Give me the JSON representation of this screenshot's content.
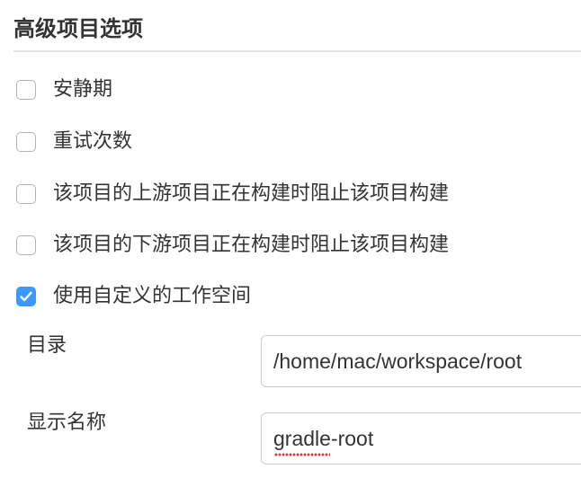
{
  "section": {
    "title": "高级项目选项"
  },
  "options": [
    {
      "label": "安静期",
      "checked": false
    },
    {
      "label": "重试次数",
      "checked": false
    },
    {
      "label": "该项目的上游项目正在构建时阻止该项目构建",
      "checked": false
    },
    {
      "label": "该项目的下游项目正在构建时阻止该项目构建",
      "checked": false
    },
    {
      "label": "使用自定义的工作空间",
      "checked": true
    }
  ],
  "workspace": {
    "directory_label": "目录",
    "directory_value": "/home/mac/workspace/root",
    "display_name_label": "显示名称",
    "display_name_value": "gradle-root"
  },
  "colors": {
    "checkbox_checked": "#3b99fc",
    "checkbox_border": "#b4b4b4",
    "text": "#333333",
    "divider": "#e5e5e5",
    "spellcheck_underline": "#e8323c"
  }
}
